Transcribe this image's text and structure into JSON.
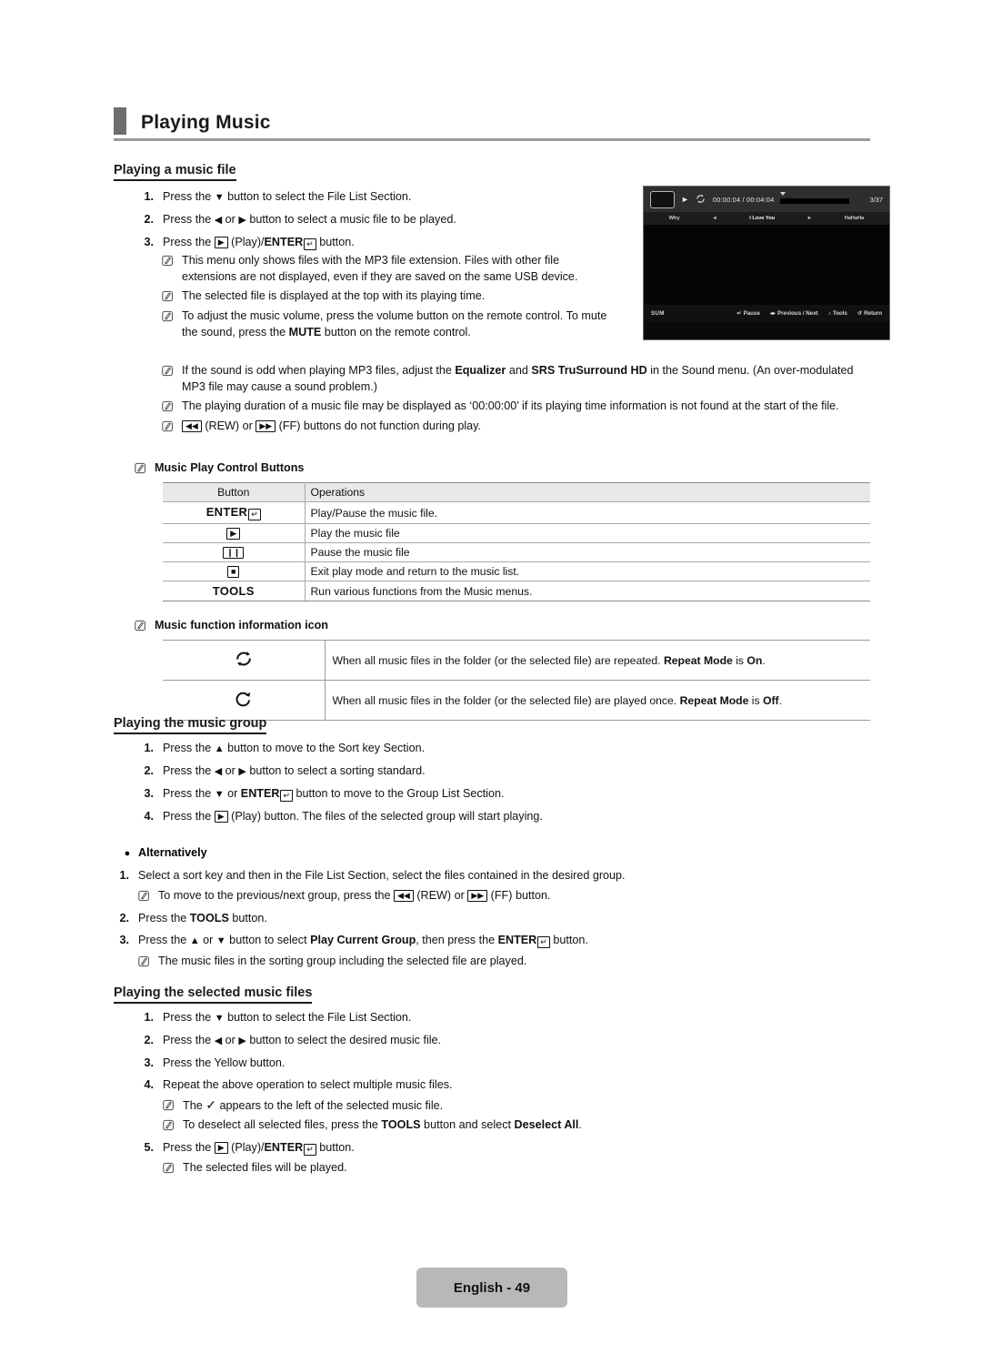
{
  "header": {
    "title": "Playing Music"
  },
  "sections": {
    "music_file": {
      "heading": "Playing a music file",
      "steps": [
        {
          "num": "1.",
          "pre": "Press the ",
          "post": " button to select the File List Section."
        },
        {
          "num": "2.",
          "pre": "Press the ",
          "post": " button to select a music file to be played."
        },
        {
          "num": "3.",
          "pre": "Press the ",
          "post": " button."
        }
      ],
      "notes": [
        "This menu only shows files with the MP3 file extension. Files with other file extensions are not displayed, even if they are saved on the same USB device.",
        "The selected file is displayed at the top with its playing time.",
        "To adjust the music volume, press the volume button on the remote control. To mute the sound, press the MUTE button on the remote control.",
        "If the sound is odd when playing MP3 files, adjust the Equalizer and SRS TruSurround HD in the Sound menu. (An over-modulated MP3 file may cause a sound problem.)",
        "The playing duration of a music file may be displayed as ‘00:00:00’ if its playing time information is not found at the start of the file.",
        "(REW) or (FF) buttons do not function during play."
      ],
      "control_buttons_title": "Music Play Control Buttons",
      "control_table": {
        "columns": [
          "Button",
          "Operations"
        ],
        "rows": [
          {
            "button": "ENTER",
            "operation": "Play/Pause the music file."
          },
          {
            "button": "play",
            "operation": "Play the music file"
          },
          {
            "button": "pause",
            "operation": "Pause the music file"
          },
          {
            "button": "stop",
            "operation": "Exit play mode and return to the music list."
          },
          {
            "button": "TOOLS",
            "operation": "Run various functions from the Music menus."
          }
        ]
      },
      "info_icon_title": "Music function information icon",
      "info_table": {
        "rows": [
          {
            "icon": "repeat-all-icon",
            "text": "When all music files in the folder (or the selected file) are repeated. Repeat Mode is On."
          },
          {
            "icon": "repeat-once-icon",
            "text": "When all music files in the folder (or the selected file) are played once. Repeat Mode is Off."
          }
        ]
      }
    },
    "music_group": {
      "heading": "Playing the music group",
      "steps": [
        {
          "num": "1.",
          "pre": "Press the ",
          "post": " button to move to the Sort key Section."
        },
        {
          "num": "2.",
          "pre": "Press the ",
          "post": " button to select a sorting standard."
        },
        {
          "num": "3.",
          "pre": "Press the ",
          "post": " button to move to the Group List Section."
        },
        {
          "num": "4.",
          "pre": "Press the ",
          "post": " (Play) button. The files of the selected group will start playing."
        }
      ],
      "alternatively_label": "Alternatively",
      "alt_steps": [
        {
          "num": "1.",
          "text": "Select a sort key and then in the File List Section, select the files contained in the desired group."
        },
        {
          "num": "2.",
          "text": "Press the TOOLS button."
        },
        {
          "num": "3.",
          "text": "Press the ▲ or ▼ button to select Play Current Group, then press the ENTER button."
        }
      ],
      "alt_note_1": "To move to the previous/next group, press the (REW) or (FF) button.",
      "alt_note_3": "The music files in the sorting group including the selected file are played."
    },
    "selected_files": {
      "heading": "Playing the selected music files",
      "steps": [
        {
          "num": "1.",
          "text": "Press the ▼ button to select the File List Section."
        },
        {
          "num": "2.",
          "text": "Press the ◄ or ► button to select the desired music file."
        },
        {
          "num": "3.",
          "text": "Press the Yellow button."
        },
        {
          "num": "4.",
          "text": "Repeat the above operation to select multiple music files."
        },
        {
          "num": "5.",
          "text": "Press the (Play)/ENTER button."
        }
      ],
      "notes": {
        "check": "appears to the left of the selected music file.",
        "check_pre": "The",
        "deselect": "To deselect all selected files, press the TOOLS button and select Deselect All.",
        "played": "The selected files will be played."
      }
    }
  },
  "tv_screenshot": {
    "elapsed_total": "00:00:04 / 00:04:04",
    "track_count": "3/37",
    "nav": {
      "prev_label": "Why",
      "current": "I Love You",
      "next_label": "HaHaHa"
    },
    "footer": {
      "source": "SUM",
      "pause": "Pause",
      "prev_next": "Previous / Next",
      "tools": "Tools",
      "return": "Return"
    }
  },
  "footer": {
    "page_label": "English - 49"
  }
}
